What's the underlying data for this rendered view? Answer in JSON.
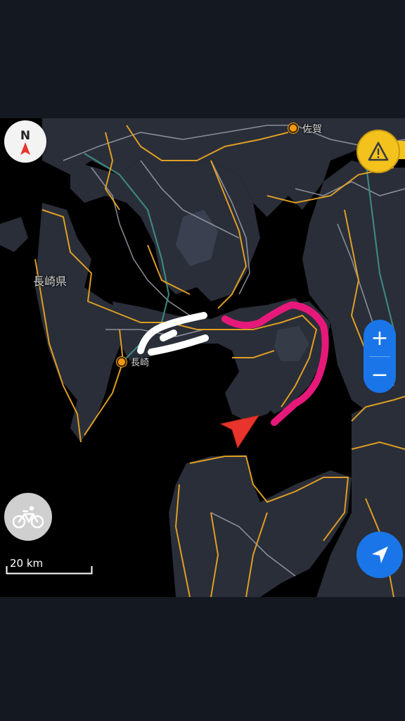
{
  "map": {
    "labels": {
      "prefecture": "長崎県",
      "city_nagasaki": "長崎",
      "city_saga": "佐賀"
    },
    "scale": "20 km",
    "colors": {
      "road_primary": "#e8a423",
      "road_secondary": "#9a9ea8",
      "rail": "#3f8f86",
      "land": "#2a2e38",
      "water": "#000000",
      "drawn_route_white": "#ffffff",
      "drawn_route_pink": "#e6197a",
      "position_arrow": "#e8342c",
      "accent_blue": "#1a76e8",
      "warning_yellow": "#f4c21c"
    }
  },
  "controls": {
    "compass_letter": "N",
    "compass_icon": "compass-north-icon",
    "warning_icon": "warning-triangle-icon",
    "zoom_in_label": "+",
    "zoom_out_label": "−",
    "profile_icon": "bicycle-icon",
    "locate_icon": "navigation-arrow-icon"
  }
}
